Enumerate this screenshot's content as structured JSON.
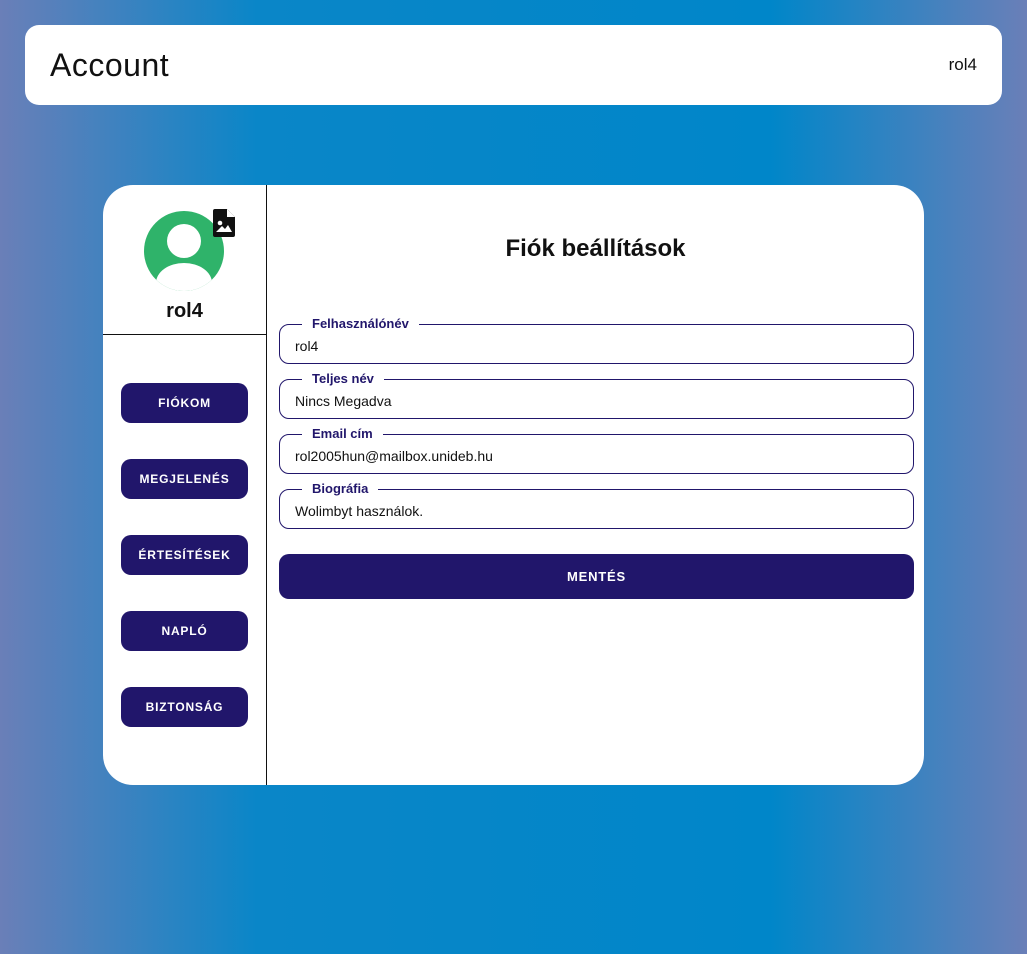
{
  "header": {
    "title": "Account",
    "username": "rol4"
  },
  "profile": {
    "username": "rol4",
    "avatar_color": "#2fb36a",
    "avatar_icon": "user-avatar-icon",
    "upload_icon": "image-file-icon"
  },
  "sidebar": {
    "items": [
      {
        "label": "FIÓKOM"
      },
      {
        "label": "MEGJELENÉS"
      },
      {
        "label": "ÉRTESÍTÉSEK"
      },
      {
        "label": "NAPLÓ"
      },
      {
        "label": "BIZTONSÁG"
      }
    ]
  },
  "main": {
    "heading": "Fiók beállítások",
    "fields": [
      {
        "label": "Felhasználónév",
        "value": "rol4"
      },
      {
        "label": "Teljes név",
        "value": "Nincs Megadva"
      },
      {
        "label": "Email cím",
        "value": "rol2005hun@mailbox.unideb.hu"
      },
      {
        "label": "Biográfia",
        "value": "Wolimbyt használok."
      }
    ],
    "save_label": "MENTÉS"
  },
  "colors": {
    "accent": "#21166b",
    "background_center": "#0086c9",
    "background_edge": "#6a7fb8"
  }
}
